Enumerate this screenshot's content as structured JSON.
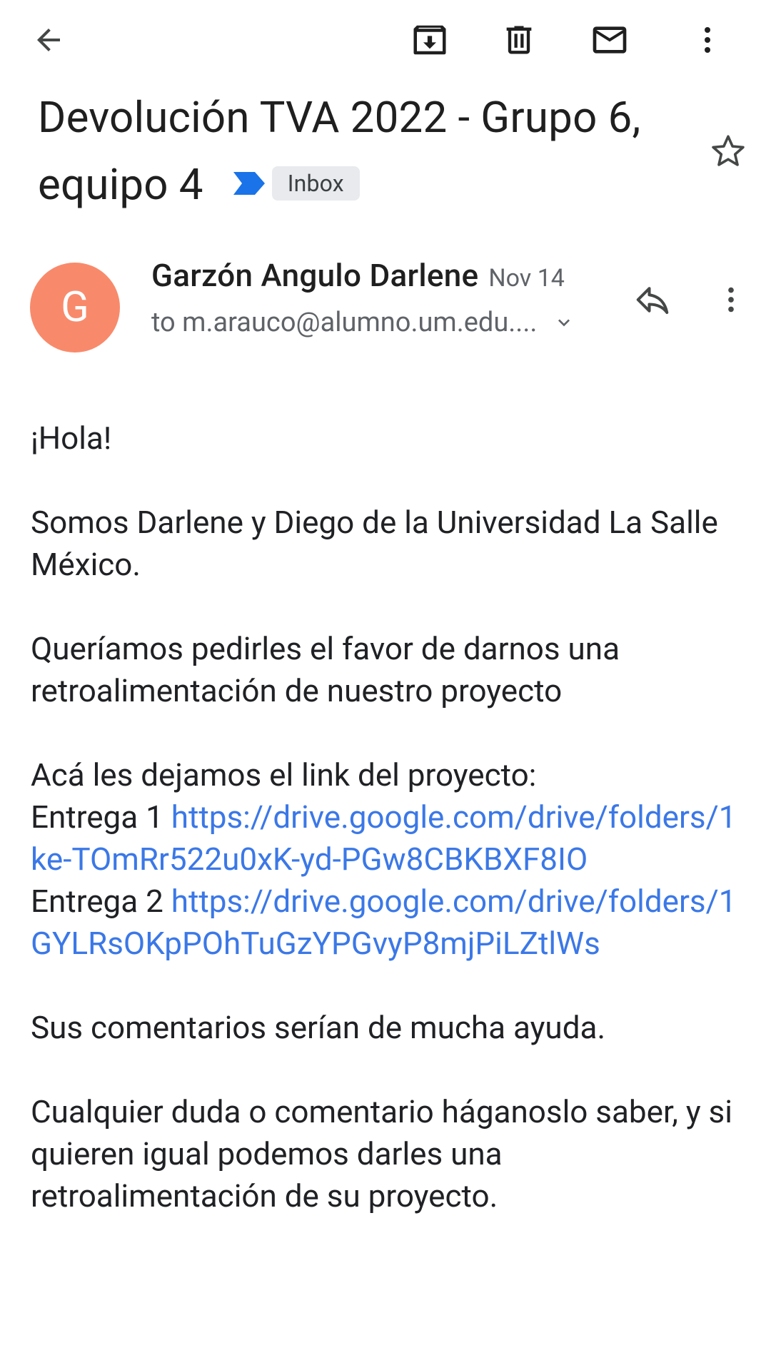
{
  "toolbar": {
    "back_icon": "arrow-back-icon",
    "archive_icon": "archive-icon",
    "delete_icon": "trash-icon",
    "mark_unread_icon": "mail-icon",
    "more_icon": "more-vert-icon"
  },
  "email": {
    "subject": "Devolución TVA 2022 - Grupo 6, equipo 4",
    "label": "Inbox",
    "importance_color": "#1a73e8",
    "starred": false,
    "sender": {
      "initial": "G",
      "avatar_color": "#f88a6b",
      "name": "Garzón Angulo Darlene",
      "date": "Nov 14",
      "recipient": "to m.arauco@alumno.um.edu...."
    },
    "body": {
      "greeting": "¡Hola!",
      "intro": "Somos Darlene y Diego de la Universidad La Salle México.",
      "request": "Queríamos pedirles el favor de darnos una retroalimentación de nuestro proyecto",
      "links_intro": "Acá les dejamos el link del proyecto:",
      "entrega1_label": "Entrega 1 ",
      "entrega1_url": "https://drive.google.com/drive/folders/1ke-TOmRr522u0xK-yd-PGw8CBKBXF8IO",
      "entrega2_label": "Entrega 2 ",
      "entrega2_url": "https://drive.google.com/drive/folders/1GYLRsOKpPOhTuGzYPGvyP8mjPiLZtlWs",
      "thanks": "Sus comentarios serían de mucha ayuda.",
      "closing": "Cualquier duda o comentario háganoslo saber, y si quieren igual podemos darles una retroalimentación de su proyecto."
    }
  }
}
